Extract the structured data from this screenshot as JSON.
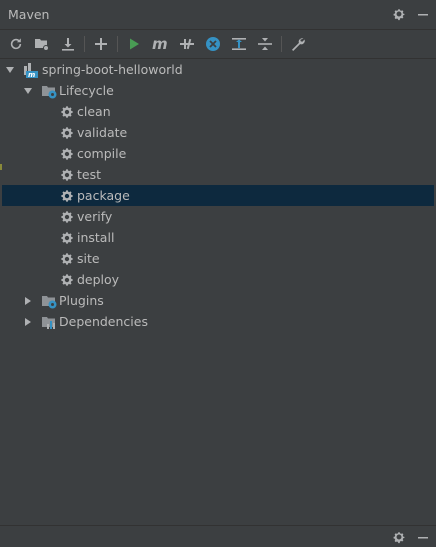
{
  "header": {
    "title": "Maven",
    "settings_icon": "gear-icon",
    "hide_icon": "minimize-icon"
  },
  "toolbar": {
    "buttons": [
      {
        "name": "reload-icon"
      },
      {
        "name": "generate-sources-icon"
      },
      {
        "name": "download-sources-icon"
      },
      {
        "name": "add-maven-project-icon"
      },
      {
        "name": "run-icon"
      },
      {
        "name": "execute-goal-icon"
      },
      {
        "name": "toggle-offline-icon"
      },
      {
        "name": "skip-tests-icon"
      },
      {
        "name": "show-dependencies-icon"
      },
      {
        "name": "collapse-all-icon"
      },
      {
        "name": "settings-wrench-icon"
      }
    ]
  },
  "tree": {
    "project": "spring-boot-helloworld",
    "lifecycle": {
      "label": "Lifecycle",
      "goals": [
        "clean",
        "validate",
        "compile",
        "test",
        "package",
        "verify",
        "install",
        "site",
        "deploy"
      ],
      "selected": "package"
    },
    "plugins": "Plugins",
    "dependencies": "Dependencies"
  },
  "colors": {
    "background": "#3c3f41",
    "selection": "#0d293e",
    "text": "#bbbbbb",
    "run_green": "#499c54",
    "accent_blue": "#3592c4"
  }
}
